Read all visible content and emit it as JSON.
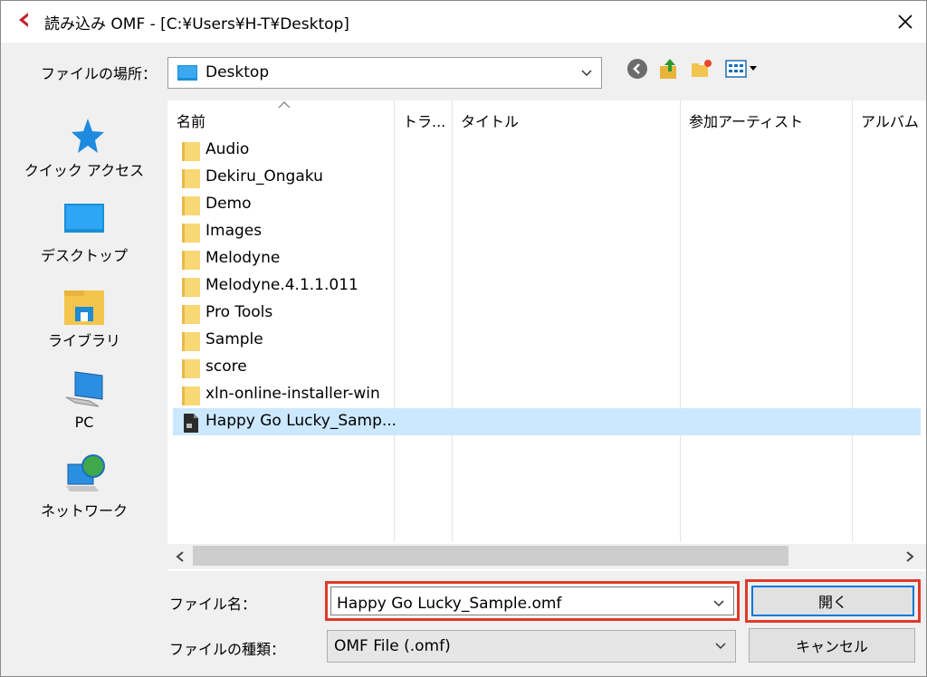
{
  "window": {
    "title": "読み込み OMF - [C:¥Users¥H-T¥Desktop]"
  },
  "location": {
    "label": "ファイルの場所：",
    "value": "Desktop"
  },
  "places": [
    {
      "label": "クイック アクセス",
      "icon": "star-icon"
    },
    {
      "label": "デスクトップ",
      "icon": "desktop-icon"
    },
    {
      "label": "ライブラリ",
      "icon": "library-icon"
    },
    {
      "label": "PC",
      "icon": "pc-icon"
    },
    {
      "label": "ネットワーク",
      "icon": "network-icon"
    }
  ],
  "columns": [
    "名前",
    "トラ...",
    "タイトル",
    "参加アーティスト",
    "アルバム"
  ],
  "files": [
    {
      "name": "Audio",
      "type": "folder"
    },
    {
      "name": "Dekiru_Ongaku",
      "type": "folder"
    },
    {
      "name": "Demo",
      "type": "folder"
    },
    {
      "name": "Images",
      "type": "folder"
    },
    {
      "name": "Melodyne",
      "type": "folder"
    },
    {
      "name": "Melodyne.4.1.1.011",
      "type": "folder"
    },
    {
      "name": "Pro Tools",
      "type": "folder"
    },
    {
      "name": "Sample",
      "type": "folder"
    },
    {
      "name": "score",
      "type": "folder"
    },
    {
      "name": "xln-online-installer-win",
      "type": "folder"
    },
    {
      "name": "Happy Go Lucky_Samp...",
      "type": "file",
      "selected": true
    }
  ],
  "filename": {
    "label": "ファイル名：",
    "value": "Happy Go Lucky_Sample.omf"
  },
  "filetype": {
    "label": "ファイルの種類：",
    "value": "OMF File (.omf)"
  },
  "buttons": {
    "open": "開く",
    "cancel": "キャンセル"
  },
  "colors": {
    "highlight": "#e03a2a",
    "selection": "#cce8ff",
    "focus": "#0078d7",
    "folder": "#f8d775"
  }
}
